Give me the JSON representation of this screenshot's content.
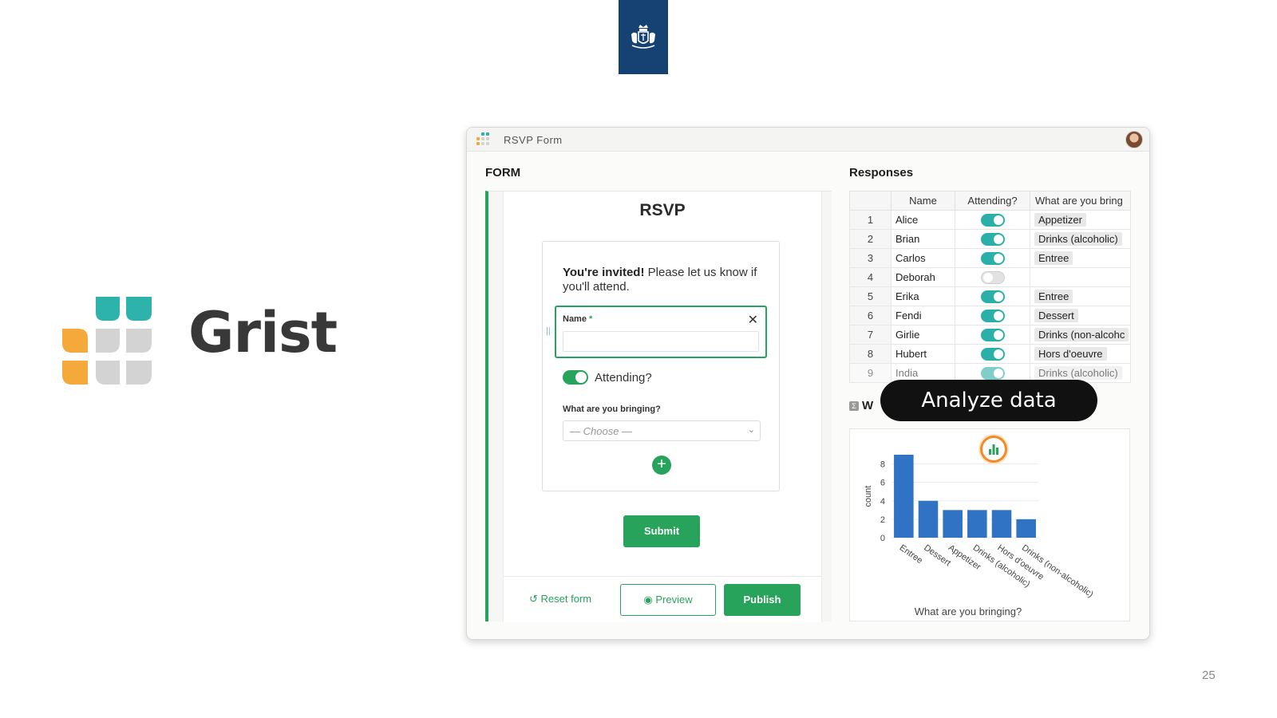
{
  "slide": {
    "page_number": "25"
  },
  "brand": {
    "name": "Grist"
  },
  "window": {
    "title": "RSVP Form",
    "form_section_title": "FORM",
    "responses_section_title": "Responses"
  },
  "form": {
    "title": "RSVP",
    "invite_bold": "You're invited!",
    "invite_rest": " Please let us know if you'll attend.",
    "name_label": "Name",
    "required_mark": "*",
    "attending_label": "Attending?",
    "bring_label": "What are you bringing?",
    "bring_placeholder": "— Choose —",
    "submit_label": "Submit",
    "reset_label": "Reset form",
    "preview_label": "Preview",
    "publish_label": "Publish"
  },
  "responses": {
    "columns": [
      "Name",
      "Attending?",
      "What are you bring"
    ],
    "rows": [
      {
        "n": "1",
        "name": "Alice",
        "attending": true,
        "bringing": "Appetizer"
      },
      {
        "n": "2",
        "name": "Brian",
        "attending": true,
        "bringing": "Drinks (alcoholic)"
      },
      {
        "n": "3",
        "name": "Carlos",
        "attending": true,
        "bringing": "Entree"
      },
      {
        "n": "4",
        "name": "Deborah",
        "attending": false,
        "bringing": ""
      },
      {
        "n": "5",
        "name": "Erika",
        "attending": true,
        "bringing": "Entree"
      },
      {
        "n": "6",
        "name": "Fendi",
        "attending": true,
        "bringing": "Dessert"
      },
      {
        "n": "7",
        "name": "Girlie",
        "attending": true,
        "bringing": "Drinks (non-alcohc"
      },
      {
        "n": "8",
        "name": "Hubert",
        "attending": true,
        "bringing": "Hors d'oeuvre"
      },
      {
        "n": "9",
        "name": "India",
        "attending": true,
        "bringing": "Drinks (alcoholic)"
      }
    ]
  },
  "widget": {
    "title_visible": "W",
    "overlay_label": "Analyze data"
  },
  "chart_data": {
    "type": "bar",
    "categories": [
      "Entree",
      "Dessert",
      "Appetizer",
      "Drinks (alcoholic)",
      "Hors d'oeuvre",
      "Drinks (non-alcoholic)"
    ],
    "values": [
      9,
      4,
      3,
      3,
      3,
      2
    ],
    "xlabel": "What are you bringing?",
    "ylabel": "count",
    "yticks": [
      0,
      2,
      4,
      6,
      8
    ],
    "ylim": [
      0,
      9
    ],
    "bar_color": "#3072c4",
    "grid": true
  },
  "colors": {
    "accent": "#27a35b",
    "toggle": "#2ab0a8",
    "emblem_bg": "#154273",
    "highlight": "#f28a25"
  }
}
